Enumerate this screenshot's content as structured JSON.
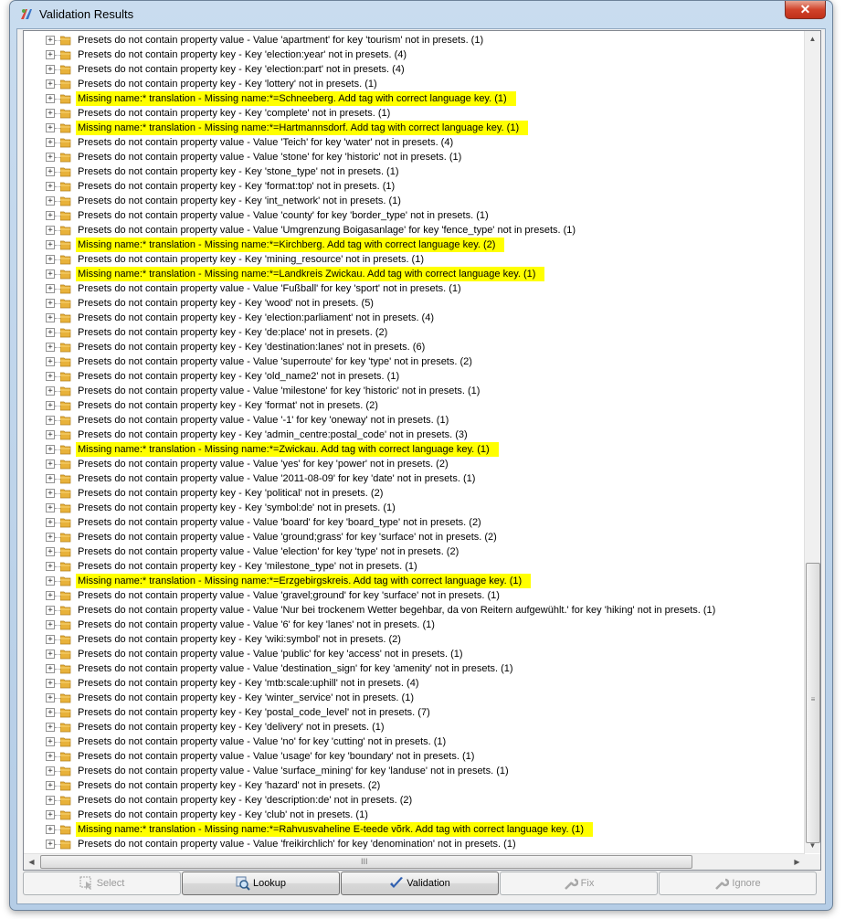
{
  "window": {
    "title": "Validation Results",
    "close_glyph": "✕"
  },
  "tree": {
    "expand_glyph": "+",
    "rows": [
      {
        "text": "Presets do not contain property value - Value 'apartment' for key 'tourism' not in presets. (1)",
        "highlight": false
      },
      {
        "text": "Presets do not contain property key - Key 'election:year' not in presets. (4)",
        "highlight": false
      },
      {
        "text": "Presets do not contain property key - Key 'election:part' not in presets. (4)",
        "highlight": false
      },
      {
        "text": "Presets do not contain property key - Key 'lottery' not in presets. (1)",
        "highlight": false
      },
      {
        "text": "Missing name:* translation - Missing name:*=Schneeberg. Add tag with correct language key. (1)",
        "highlight": true
      },
      {
        "text": "Presets do not contain property key - Key 'complete' not in presets. (1)",
        "highlight": false
      },
      {
        "text": "Missing name:* translation - Missing name:*=Hartmannsdorf. Add tag with correct language key. (1)",
        "highlight": true
      },
      {
        "text": "Presets do not contain property value - Value 'Teich' for key 'water' not in presets. (4)",
        "highlight": false
      },
      {
        "text": "Presets do not contain property value - Value 'stone' for key 'historic' not in presets. (1)",
        "highlight": false
      },
      {
        "text": "Presets do not contain property key - Key 'stone_type' not in presets. (1)",
        "highlight": false
      },
      {
        "text": "Presets do not contain property key - Key 'format:top' not in presets. (1)",
        "highlight": false
      },
      {
        "text": "Presets do not contain property key - Key 'int_network' not in presets. (1)",
        "highlight": false
      },
      {
        "text": "Presets do not contain property value - Value 'county' for key 'border_type' not in presets. (1)",
        "highlight": false
      },
      {
        "text": "Presets do not contain property value - Value 'Umgrenzung Boigasanlage' for key 'fence_type' not in presets. (1)",
        "highlight": false
      },
      {
        "text": "Missing name:* translation - Missing name:*=Kirchberg. Add tag with correct language key. (2)",
        "highlight": true
      },
      {
        "text": "Presets do not contain property key - Key 'mining_resource' not in presets. (1)",
        "highlight": false
      },
      {
        "text": "Missing name:* translation - Missing name:*=Landkreis Zwickau. Add tag with correct language key. (1)",
        "highlight": true
      },
      {
        "text": "Presets do not contain property value - Value 'Fußball' for key 'sport' not in presets. (1)",
        "highlight": false
      },
      {
        "text": "Presets do not contain property key - Key 'wood' not in presets. (5)",
        "highlight": false
      },
      {
        "text": "Presets do not contain property key - Key 'election:parliament' not in presets. (4)",
        "highlight": false
      },
      {
        "text": "Presets do not contain property key - Key 'de:place' not in presets. (2)",
        "highlight": false
      },
      {
        "text": "Presets do not contain property key - Key 'destination:lanes' not in presets. (6)",
        "highlight": false
      },
      {
        "text": "Presets do not contain property value - Value 'superroute' for key 'type' not in presets. (2)",
        "highlight": false
      },
      {
        "text": "Presets do not contain property key - Key 'old_name2' not in presets. (1)",
        "highlight": false
      },
      {
        "text": "Presets do not contain property value - Value 'milestone' for key 'historic' not in presets. (1)",
        "highlight": false
      },
      {
        "text": "Presets do not contain property key - Key 'format' not in presets. (2)",
        "highlight": false
      },
      {
        "text": "Presets do not contain property value - Value '-1' for key 'oneway' not in presets. (1)",
        "highlight": false
      },
      {
        "text": "Presets do not contain property key - Key 'admin_centre:postal_code' not in presets. (3)",
        "highlight": false
      },
      {
        "text": "Missing name:* translation - Missing name:*=Zwickau. Add tag with correct language key. (1)",
        "highlight": true
      },
      {
        "text": "Presets do not contain property value - Value 'yes' for key 'power' not in presets. (2)",
        "highlight": false
      },
      {
        "text": "Presets do not contain property value - Value '2011-08-09' for key 'date' not in presets. (1)",
        "highlight": false
      },
      {
        "text": "Presets do not contain property key - Key 'political' not in presets. (2)",
        "highlight": false
      },
      {
        "text": "Presets do not contain property key - Key 'symbol:de' not in presets. (1)",
        "highlight": false
      },
      {
        "text": "Presets do not contain property value - Value 'board' for key 'board_type' not in presets. (2)",
        "highlight": false
      },
      {
        "text": "Presets do not contain property value - Value 'ground;grass' for key 'surface' not in presets. (2)",
        "highlight": false
      },
      {
        "text": "Presets do not contain property value - Value 'election' for key 'type' not in presets. (2)",
        "highlight": false
      },
      {
        "text": "Presets do not contain property key - Key 'milestone_type' not in presets. (1)",
        "highlight": false
      },
      {
        "text": "Missing name:* translation - Missing name:*=Erzgebirgskreis. Add tag with correct language key. (1)",
        "highlight": true
      },
      {
        "text": "Presets do not contain property value - Value 'gravel;ground' for key 'surface' not in presets. (1)",
        "highlight": false
      },
      {
        "text": "Presets do not contain property value - Value 'Nur bei trockenem Wetter begehbar, da von Reitern aufgewühlt.' for key 'hiking' not in presets. (1)",
        "highlight": false
      },
      {
        "text": "Presets do not contain property value - Value '6' for key 'lanes' not in presets. (1)",
        "highlight": false
      },
      {
        "text": "Presets do not contain property key - Key 'wiki:symbol' not in presets. (2)",
        "highlight": false
      },
      {
        "text": "Presets do not contain property value - Value 'public' for key 'access' not in presets. (1)",
        "highlight": false
      },
      {
        "text": "Presets do not contain property value - Value 'destination_sign' for key 'amenity' not in presets. (1)",
        "highlight": false
      },
      {
        "text": "Presets do not contain property key - Key 'mtb:scale:uphill' not in presets. (4)",
        "highlight": false
      },
      {
        "text": "Presets do not contain property key - Key 'winter_service' not in presets. (1)",
        "highlight": false
      },
      {
        "text": "Presets do not contain property key - Key 'postal_code_level' not in presets. (7)",
        "highlight": false
      },
      {
        "text": "Presets do not contain property key - Key 'delivery' not in presets. (1)",
        "highlight": false
      },
      {
        "text": "Presets do not contain property value - Value 'no' for key 'cutting' not in presets. (1)",
        "highlight": false
      },
      {
        "text": "Presets do not contain property value - Value 'usage' for key 'boundary' not in presets. (1)",
        "highlight": false
      },
      {
        "text": "Presets do not contain property value - Value 'surface_mining' for key 'landuse' not in presets. (1)",
        "highlight": false
      },
      {
        "text": "Presets do not contain property key - Key 'hazard' not in presets. (2)",
        "highlight": false
      },
      {
        "text": "Presets do not contain property key - Key 'description:de' not in presets. (2)",
        "highlight": false
      },
      {
        "text": "Presets do not contain property key - Key 'club' not in presets. (1)",
        "highlight": false
      },
      {
        "text": "Missing name:* translation - Missing name:*=Rahvusvaheline E-teede võrk. Add tag with correct language key. (1)",
        "highlight": true
      },
      {
        "text": "Presets do not contain property value - Value 'freikirchlich' for key 'denomination' not in presets. (1)",
        "highlight": false
      }
    ]
  },
  "scrollbars": {
    "up": "▲",
    "down": "▼",
    "left": "◀",
    "right": "▶",
    "v_grip": "≡",
    "h_grip": "III"
  },
  "buttons": {
    "select": {
      "label": "Select",
      "enabled": false,
      "icon": "select-cursor-icon"
    },
    "lookup": {
      "label": "Lookup",
      "enabled": true,
      "icon": "lookup-magnifier-icon"
    },
    "validation": {
      "label": "Validation",
      "enabled": true,
      "icon": "checkmark-icon"
    },
    "fix": {
      "label": "Fix",
      "enabled": false,
      "icon": "wrench-icon"
    },
    "ignore": {
      "label": "Ignore",
      "enabled": false,
      "icon": "wrench-icon"
    }
  },
  "colors": {
    "highlight": "#ffff00",
    "folder": "#e8b23a",
    "title_bar": "#c9dcef",
    "close": "#c0301a"
  }
}
